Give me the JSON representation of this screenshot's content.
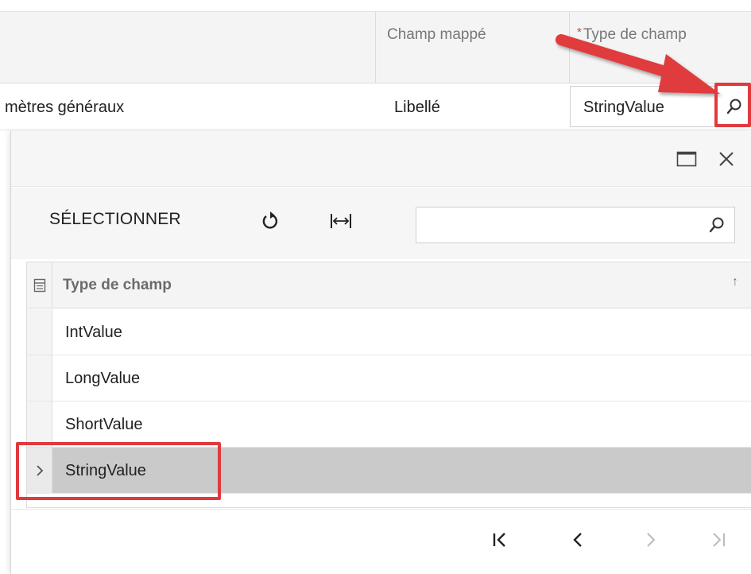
{
  "grid": {
    "columns": {
      "mapped_field": "Champ mappé",
      "field_type_required_mark": "*",
      "field_type": "Type de champ"
    },
    "row": {
      "params": "mètres généraux",
      "label": "Libellé",
      "field_type_value": "StringValue"
    }
  },
  "popup": {
    "toolbar": {
      "select_label": "SÉLECTIONNER",
      "search_value": ""
    },
    "list": {
      "column_header": "Type de champ",
      "sort_indicator": "↑",
      "items": [
        {
          "value": "IntValue"
        },
        {
          "value": "LongValue"
        },
        {
          "value": "ShortValue"
        },
        {
          "value": "StringValue",
          "selected": true
        }
      ]
    }
  },
  "icons": {
    "lookup": "magnifier-icon",
    "maximize": "maximize-icon",
    "close": "close-icon",
    "refresh": "refresh-icon",
    "fit_columns": "fit-columns-icon",
    "search": "search-icon",
    "column_chooser": "column-chooser-icon",
    "row_pointer": "row-pointer-icon",
    "first_page": "first-page-icon",
    "prev_page": "prev-page-icon",
    "next_page": "next-page-icon",
    "last_page": "last-page-icon"
  },
  "colors": {
    "annotation": "#e03a3e",
    "required_mark": "#e53935",
    "selected_row": "#cacaca"
  }
}
